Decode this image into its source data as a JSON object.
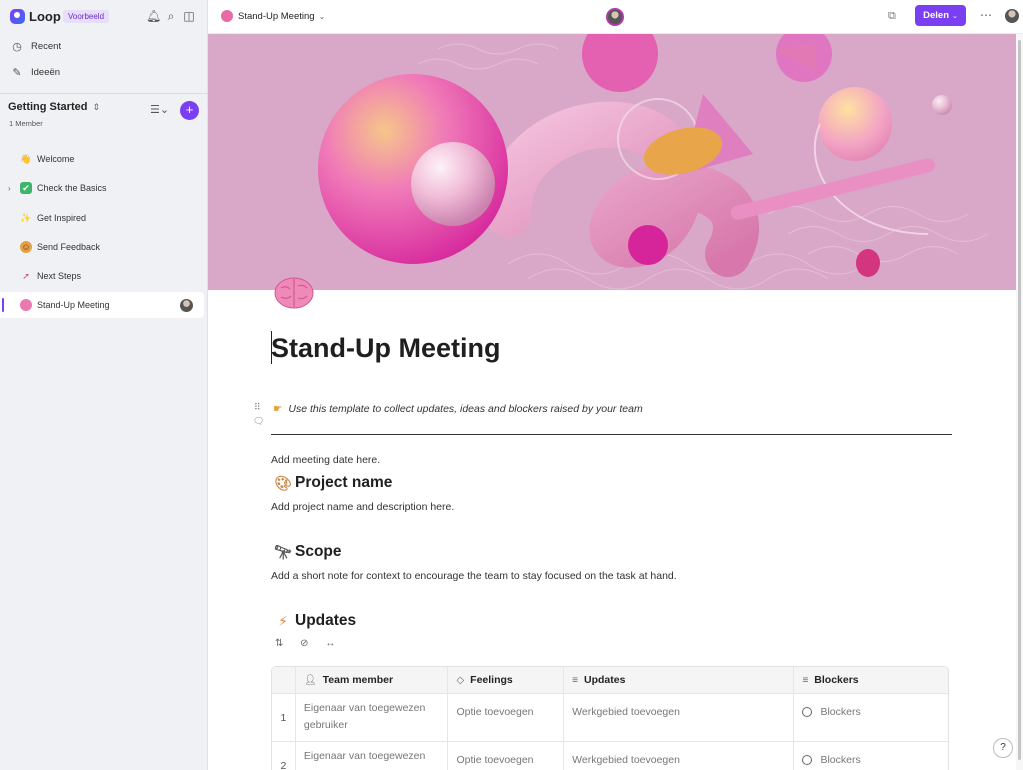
{
  "app": {
    "name": "Loop",
    "badge": "Voorbeeld"
  },
  "sidebar": {
    "nav": [
      {
        "label": "Recent",
        "icon": "clock-icon"
      },
      {
        "label": "Ideeën",
        "icon": "idea-icon"
      }
    ],
    "workspace": {
      "title": "Getting Started",
      "members": "1 Member"
    },
    "pages": [
      {
        "label": "Welcome",
        "emoji": "👋"
      },
      {
        "label": "Check the Basics",
        "emoji": "✔"
      },
      {
        "label": "Get Inspired",
        "emoji": "✨"
      },
      {
        "label": "Send Feedback",
        "emoji": "☺"
      },
      {
        "label": "Next Steps",
        "emoji": "➚"
      },
      {
        "label": "Stand-Up Meeting",
        "emoji": "🧠"
      }
    ]
  },
  "topbar": {
    "doc_title": "Stand-Up Meeting",
    "share_label": "Delen"
  },
  "document": {
    "title": "Stand-Up Meeting",
    "tip": "Use this template to collect updates, ideas and blockers raised by your team",
    "meeting_date": "Add meeting date here.",
    "sections": [
      {
        "heading": "Project name",
        "text": "Add project name and description here."
      },
      {
        "heading": "Scope",
        "text": "Add a short note for context to encourage the team to stay focused on the task at hand."
      },
      {
        "heading": "Updates"
      }
    ]
  },
  "table": {
    "columns": [
      "Team member",
      "Feelings",
      "Updates",
      "Blockers"
    ],
    "rows": [
      {
        "num": "1",
        "member": "Eigenaar van toegewezen gebruiker",
        "feelings": "Optie toevoegen",
        "updates": "Werkgebied toevoegen",
        "blockers": "Blockers"
      },
      {
        "num": "2",
        "member": "Eigenaar van toegewezen",
        "feelings": "Optie toevoegen",
        "updates": "Werkgebied toevoegen",
        "blockers": "Blockers"
      }
    ]
  },
  "help_label": "?"
}
